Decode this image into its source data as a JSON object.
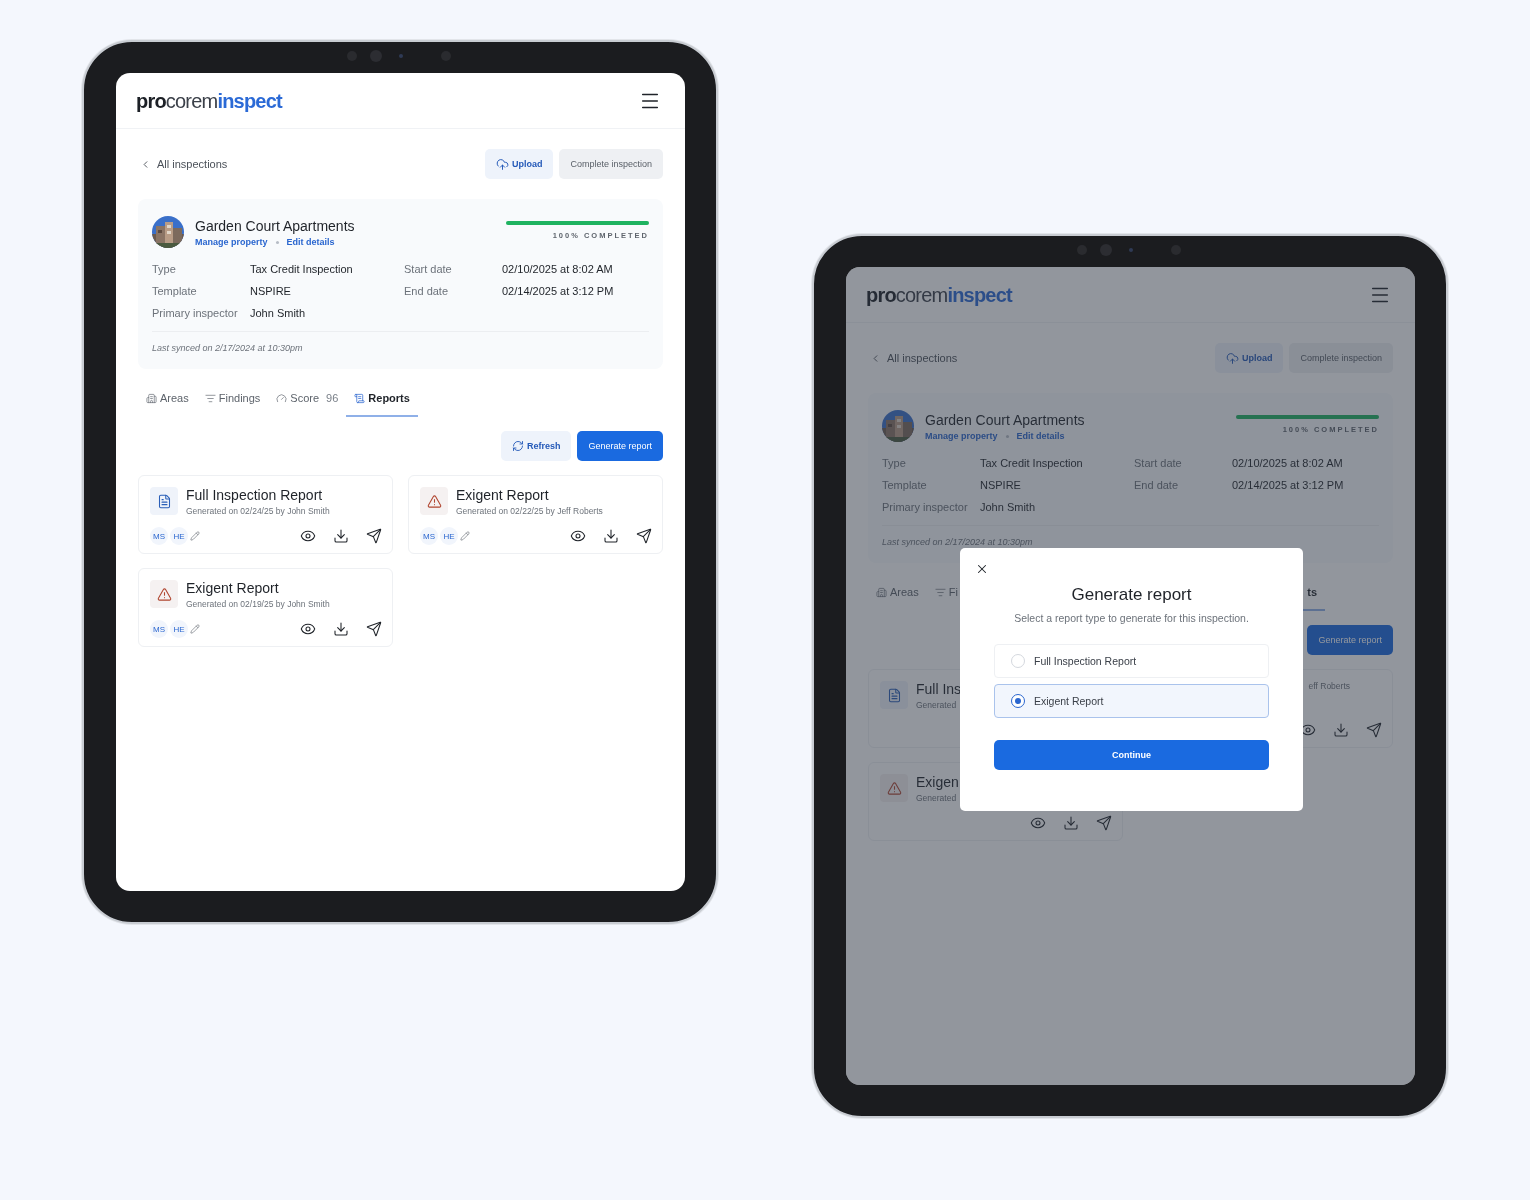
{
  "devices": [
    {
      "logo": [
        "pro",
        "corem",
        "inspect"
      ],
      "back_link": "All inspections",
      "buttons": [
        {
          "label": "Upload",
          "kind": "upload",
          "disabled": false
        },
        {
          "label": "Complete inspection",
          "kind": "plain",
          "disabled": true
        }
      ],
      "property": {
        "name": "Garden Court Apartments",
        "links": [
          "Manage property",
          "Edit details"
        ],
        "progress": {
          "level": 1,
          "label": "100% COMPLETED"
        },
        "details": [
          {
            "label": "Type",
            "value": "Tax Credit Inspection"
          },
          {
            "label": "Start date",
            "value": "02/10/2025 at 8:02 AM"
          },
          {
            "label": "Template",
            "value": "NSPIRE"
          },
          {
            "label": "End date",
            "value": "02/14/2025 at 3:12 PM"
          },
          {
            "label": "Primary inspector",
            "value": "John Smith"
          }
        ],
        "last_synced": "Last synced on 2/17/2024 at 10:30pm"
      },
      "tabs": [
        {
          "label": "Areas",
          "kind": "areas",
          "selected": false
        },
        {
          "label": "Findings",
          "kind": "findings",
          "selected": false
        },
        {
          "label": "Score",
          "count": "96",
          "kind": "score",
          "selected": false
        },
        {
          "label": "Reports",
          "kind": "reports",
          "selected": true
        }
      ],
      "actions": [
        {
          "label": "Refresh",
          "kind": "refresh"
        },
        {
          "label": "Generate report",
          "kind": "primary"
        }
      ],
      "reports": [
        {
          "kind": "document",
          "title": "Full Inspection Report",
          "subtitle": "Generated on 02/24/25 by John Smith",
          "chips": [
            "MS",
            "HE"
          ],
          "show_actions": true
        },
        {
          "kind": "warning",
          "title": "Exigent Report",
          "subtitle": "Generated on 02/22/25 by Jeff Roberts",
          "chips": [
            "MS",
            "HE"
          ],
          "show_actions": true
        },
        {
          "kind": "warning",
          "title": "Exigent Report",
          "subtitle": "Generated on 02/19/25 by John Smith",
          "chips": [
            "MS",
            "HE"
          ],
          "show_actions": true
        }
      ]
    },
    {
      "logo": [
        "pro",
        "corem",
        "inspect"
      ],
      "back_link": "All inspections",
      "buttons": [
        {
          "label": "Upload",
          "kind": "upload",
          "disabled": false
        },
        {
          "label": "Complete inspection",
          "kind": "plain",
          "disabled": true
        }
      ],
      "property": {
        "name": "Garden Court Apartments",
        "links": [
          "Manage property",
          "Edit details"
        ],
        "progress": {
          "level": 1,
          "label": "100% COMPLETED"
        },
        "details": [
          {
            "label": "Type",
            "value": "Tax Credit Inspection"
          },
          {
            "label": "Start date",
            "value": "02/10/2025 at 8:02 AM"
          },
          {
            "label": "Template",
            "value": "NSPIRE"
          },
          {
            "label": "End date",
            "value": "02/14/2025 at 3:12 PM"
          },
          {
            "label": "Primary inspector",
            "value": "John Smith"
          }
        ],
        "last_synced": "Last synced on 2/17/2024 at 10:30pm"
      },
      "tabs": [
        {
          "label": "Areas",
          "kind": "areas",
          "selected": false
        },
        {
          "label": "Fi",
          "kind": "findings",
          "selected": false
        },
        {
          "label": "ts",
          "kind": "plain",
          "selected": true
        }
      ],
      "actions": [
        {
          "label": "Generate report",
          "kind": "primary"
        }
      ],
      "reports": [
        {
          "kind": "document",
          "title": "Full Ins",
          "subtitle": "Generated",
          "show_actions": false
        },
        {
          "kind": "none",
          "subtitle": "eff Roberts",
          "show_actions": true
        },
        {
          "kind": "warning",
          "title": "Exigen",
          "subtitle": "Generated",
          "show_actions": true
        }
      ],
      "modal": {
        "title": "Generate report",
        "subtitle": "Select a report type to generate for this inspection.",
        "options": [
          {
            "label": "Full Inspection Report",
            "selected": false
          },
          {
            "label": "Exigent Report",
            "selected": true
          }
        ],
        "button": "Continue"
      }
    }
  ]
}
